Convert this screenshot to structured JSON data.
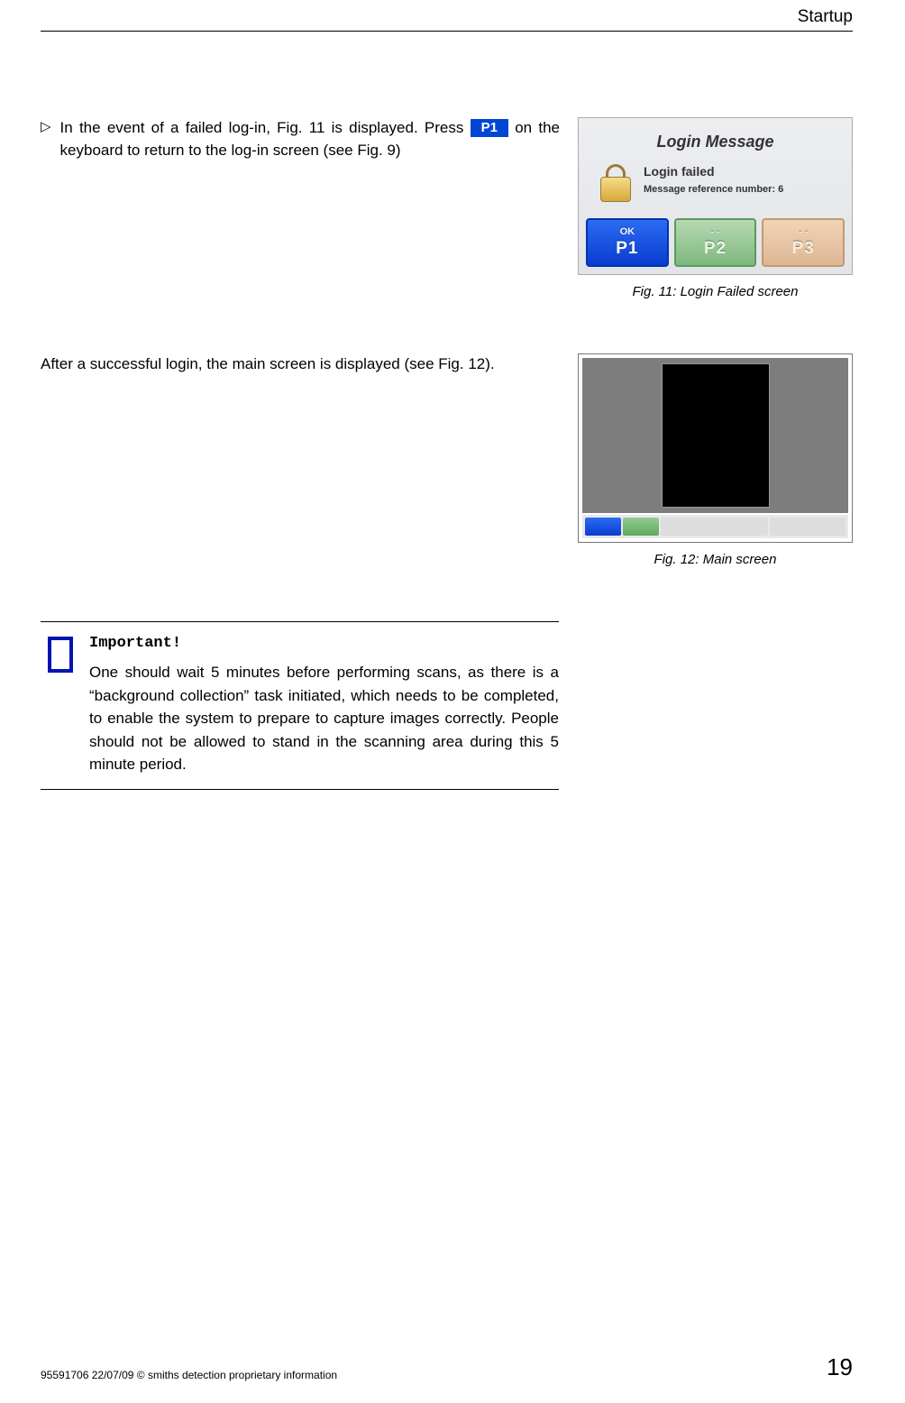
{
  "header": {
    "section": "Startup"
  },
  "step": {
    "bullet": "▷",
    "text_before": "In the event of a failed log-in, Fig. 11 is displayed. Press",
    "p1_label": "P1",
    "text_after": "on the keyboard to return to the log-in screen (see Fig. 9)"
  },
  "fig11": {
    "title": "Login Message",
    "line1": "Login failed",
    "line2": "Message reference number: 6",
    "buttons": {
      "b1_top": "OK",
      "b1_big": "P1",
      "b2_top": "- -",
      "b2_big": "P2",
      "b3_top": "- -",
      "b3_big": "P3"
    },
    "caption": "Fig. 11: Login Failed screen"
  },
  "after_login_text": "After a successful login, the main screen is displayed (see Fig. 12).",
  "fig12": {
    "caption": "Fig. 12: Main screen"
  },
  "note": {
    "heading": "Important!",
    "body": "One should wait 5 minutes before performing scans, as there is a “background collection” task initiated, which needs to be completed, to enable the system to prepare to capture images correctly. People should not be allowed to stand in the scanning area during this 5 minute period."
  },
  "footer": {
    "left": "95591706 22/07/09 ©  smiths detection proprietary information",
    "page": "19"
  }
}
